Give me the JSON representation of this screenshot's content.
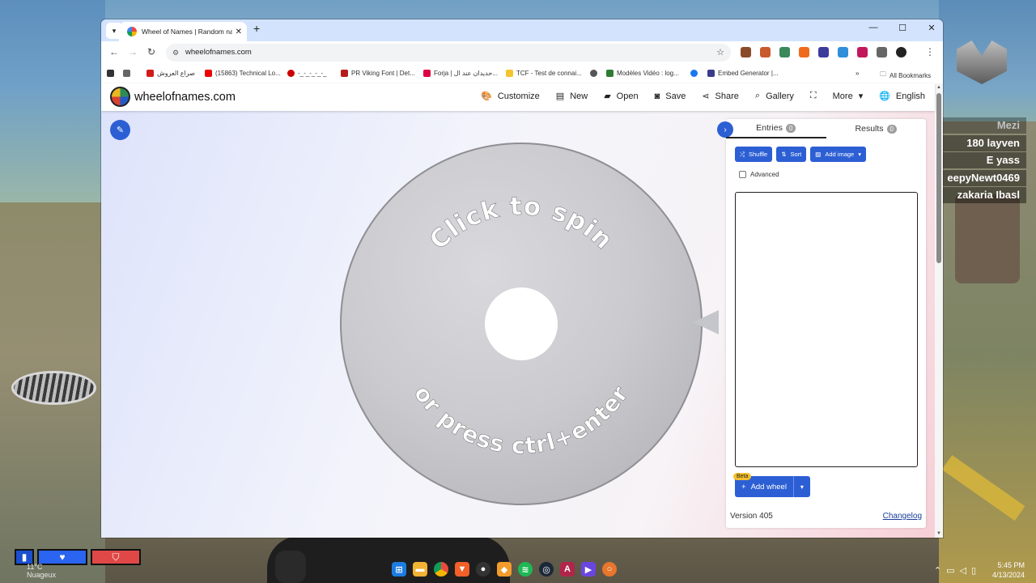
{
  "game": {
    "killfeed": [
      "Mezi",
      "180 layven",
      "E yass",
      "eepyNewt0469",
      "zakaria Ibasl"
    ],
    "hud_weather": "Nuageux",
    "hud_temp": "11°C"
  },
  "browser": {
    "tab_title": "Wheel of Names | Random nam",
    "url": "wheelofnames.com",
    "bookmarks": [
      "صراع العروش",
      "(15863) Technical Lo...",
      "-_-_-_-_-_",
      "PR Viking Font | Det...",
      "Forja | حديدان عند ال...",
      "TCF - Test de connai...",
      "",
      "Modèles Vidéo : log...",
      "",
      "Embed Generator |..."
    ],
    "all_bookmarks": "All Bookmarks"
  },
  "site": {
    "name": "wheelofnames.com",
    "nav": [
      "Customize",
      "New",
      "Open",
      "Save",
      "Share",
      "Gallery",
      "",
      "More",
      "English"
    ],
    "wheel_text_top": "Click to spin",
    "wheel_text_bottom": "or press ctrl+enter",
    "tabs": [
      {
        "label": "Entries",
        "count": "0"
      },
      {
        "label": "Results",
        "count": "0"
      }
    ],
    "buttons": {
      "shuffle": "Shuffle",
      "sort": "Sort",
      "add_image": "Add image"
    },
    "advanced": "Advanced",
    "beta": "Beta",
    "add_wheel": "Add wheel",
    "version": "Version 405",
    "changelog": "Changelog"
  },
  "taskbar": {
    "time": "5:45 PM",
    "date": "4/13/2024"
  },
  "colors": {
    "accent": "#2d5fd4",
    "tab_strip": "#d3e3fd",
    "wheel": "#c9c9cd"
  }
}
